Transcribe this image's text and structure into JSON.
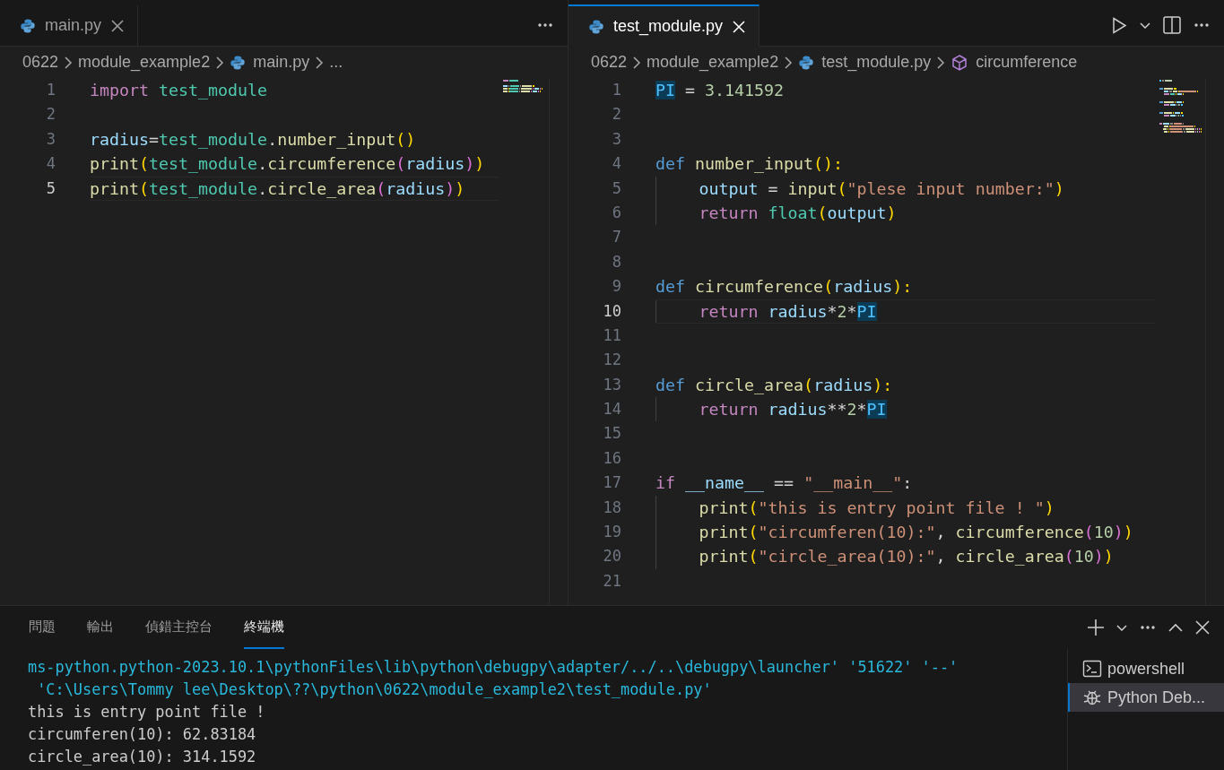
{
  "editor_groups": [
    {
      "tabs": [
        {
          "label": "main.py",
          "selected": false
        }
      ],
      "breadcrumbs": [
        {
          "label": "0622",
          "kind": "folder"
        },
        {
          "label": "module_example2",
          "kind": "folder"
        },
        {
          "label": "main.py",
          "kind": "file"
        },
        {
          "label": "...",
          "kind": "more"
        }
      ],
      "actions": [
        {
          "kind": "more"
        }
      ],
      "lines": [
        {
          "number": "1",
          "current": false,
          "nested": false,
          "tokens": [
            {
              "text": "import ",
              "kind": "kw"
            },
            {
              "text": "test_module",
              "kind": "mod"
            }
          ]
        },
        {
          "number": "2",
          "current": false,
          "nested": false
        },
        {
          "number": "3",
          "current": false,
          "nested": false,
          "tokens": [
            {
              "text": "radius",
              "kind": "var"
            },
            {
              "text": "=",
              "kind": "op"
            },
            {
              "text": "test_module",
              "kind": "mod"
            },
            {
              "text": ".",
              "kind": "op"
            },
            {
              "text": "number_input",
              "kind": "fn"
            },
            {
              "text": "()",
              "kind": "b1"
            }
          ]
        },
        {
          "number": "4",
          "current": false,
          "nested": false,
          "tokens": [
            {
              "text": "print",
              "kind": "fn"
            },
            {
              "text": "(",
              "kind": "b1"
            },
            {
              "text": "test_module",
              "kind": "mod"
            },
            {
              "text": ".",
              "kind": "op"
            },
            {
              "text": "circumference",
              "kind": "fn"
            },
            {
              "text": "(",
              "kind": "b2"
            },
            {
              "text": "radius",
              "kind": "var"
            },
            {
              "text": ")",
              "kind": "b2"
            },
            {
              "text": ")",
              "kind": "b1"
            }
          ]
        },
        {
          "number": "5",
          "current": true,
          "nested": false,
          "tokens": [
            {
              "text": "print",
              "kind": "fn"
            },
            {
              "text": "(",
              "kind": "b1"
            },
            {
              "text": "test_module",
              "kind": "mod"
            },
            {
              "text": ".",
              "kind": "op"
            },
            {
              "text": "circle_area",
              "kind": "fn"
            },
            {
              "text": "(",
              "kind": "b2"
            },
            {
              "text": "radius",
              "kind": "var"
            },
            {
              "text": ")",
              "kind": "b2"
            },
            {
              "text": ")",
              "kind": "b1"
            }
          ]
        }
      ]
    },
    {
      "tabs": [
        {
          "label": "test_module.py",
          "selected": true
        }
      ],
      "breadcrumbs": [
        {
          "label": "0622",
          "kind": "folder"
        },
        {
          "label": "module_example2",
          "kind": "folder"
        },
        {
          "label": "test_module.py",
          "kind": "file"
        },
        {
          "label": "circumference",
          "kind": "symbol"
        }
      ],
      "actions": [
        {
          "kind": "run"
        },
        {
          "kind": "menu"
        },
        {
          "kind": "split"
        },
        {
          "kind": "more"
        }
      ],
      "lines": [
        {
          "number": "1",
          "current": false,
          "nested": false,
          "tokens": [
            {
              "text": "PI",
              "kind": "match"
            },
            {
              "text": " = ",
              "kind": "op"
            },
            {
              "text": "3.141592",
              "kind": "num"
            }
          ]
        },
        {
          "number": "2",
          "current": false,
          "nested": false
        },
        {
          "number": "3",
          "current": false,
          "nested": false
        },
        {
          "number": "4",
          "current": false,
          "nested": false,
          "tokens": [
            {
              "text": "def ",
              "kind": "def"
            },
            {
              "text": "number_input",
              "kind": "fn"
            },
            {
              "text": "():",
              "kind": "b1"
            }
          ]
        },
        {
          "number": "5",
          "current": false,
          "nested": true,
          "tokens": [
            {
              "text": "output",
              "kind": "var"
            },
            {
              "text": " = ",
              "kind": "op"
            },
            {
              "text": "input",
              "kind": "fn"
            },
            {
              "text": "(",
              "kind": "b1"
            },
            {
              "text": "\"plese input number:\"",
              "kind": "str"
            },
            {
              "text": ")",
              "kind": "b1"
            }
          ]
        },
        {
          "number": "6",
          "current": false,
          "nested": true,
          "tokens": [
            {
              "text": "return ",
              "kind": "kw"
            },
            {
              "text": "float",
              "kind": "mod"
            },
            {
              "text": "(",
              "kind": "b1"
            },
            {
              "text": "output",
              "kind": "var"
            },
            {
              "text": ")",
              "kind": "b1"
            }
          ]
        },
        {
          "number": "7",
          "current": false,
          "nested": false
        },
        {
          "number": "8",
          "current": false,
          "nested": false
        },
        {
          "number": "9",
          "current": false,
          "nested": false,
          "tokens": [
            {
              "text": "def ",
              "kind": "def"
            },
            {
              "text": "circumference",
              "kind": "fn"
            },
            {
              "text": "(",
              "kind": "b1"
            },
            {
              "text": "radius",
              "kind": "var"
            },
            {
              "text": "):",
              "kind": "b1"
            }
          ]
        },
        {
          "number": "10",
          "current": true,
          "nested": true,
          "tokens": [
            {
              "text": "return ",
              "kind": "kw"
            },
            {
              "text": "radius",
              "kind": "var"
            },
            {
              "text": "*",
              "kind": "op"
            },
            {
              "text": "2",
              "kind": "num"
            },
            {
              "text": "*",
              "kind": "op"
            },
            {
              "text": "PI",
              "kind": "match"
            }
          ]
        },
        {
          "number": "11",
          "current": false,
          "nested": false
        },
        {
          "number": "12",
          "current": false,
          "nested": false
        },
        {
          "number": "13",
          "current": false,
          "nested": false,
          "tokens": [
            {
              "text": "def ",
              "kind": "def"
            },
            {
              "text": "circle_area",
              "kind": "fn"
            },
            {
              "text": "(",
              "kind": "b1"
            },
            {
              "text": "radius",
              "kind": "var"
            },
            {
              "text": "):",
              "kind": "b1"
            }
          ]
        },
        {
          "number": "14",
          "current": false,
          "nested": true,
          "tokens": [
            {
              "text": "return ",
              "kind": "kw"
            },
            {
              "text": "radius",
              "kind": "var"
            },
            {
              "text": "**",
              "kind": "op"
            },
            {
              "text": "2",
              "kind": "num"
            },
            {
              "text": "*",
              "kind": "op"
            },
            {
              "text": "PI",
              "kind": "match"
            }
          ]
        },
        {
          "number": "15",
          "current": false,
          "nested": false
        },
        {
          "number": "16",
          "current": false,
          "nested": false
        },
        {
          "number": "17",
          "current": false,
          "nested": false,
          "tokens": [
            {
              "text": "if ",
              "kind": "kw"
            },
            {
              "text": "__name__",
              "kind": "var"
            },
            {
              "text": " == ",
              "kind": "op"
            },
            {
              "text": "\"__main__\"",
              "kind": "str"
            },
            {
              "text": ":",
              "kind": "op"
            }
          ]
        },
        {
          "number": "18",
          "current": false,
          "nested": true,
          "tokens": [
            {
              "text": "print",
              "kind": "fn"
            },
            {
              "text": "(",
              "kind": "b1"
            },
            {
              "text": "\"this is entry point file ! \"",
              "kind": "str"
            },
            {
              "text": ")",
              "kind": "b1"
            }
          ]
        },
        {
          "number": "19",
          "current": false,
          "nested": true,
          "tokens": [
            {
              "text": "print",
              "kind": "fn"
            },
            {
              "text": "(",
              "kind": "b1"
            },
            {
              "text": "\"circumferen(10):\"",
              "kind": "str"
            },
            {
              "text": ", ",
              "kind": "op"
            },
            {
              "text": "circumference",
              "kind": "fn"
            },
            {
              "text": "(",
              "kind": "b2"
            },
            {
              "text": "10",
              "kind": "num"
            },
            {
              "text": ")",
              "kind": "b2"
            },
            {
              "text": ")",
              "kind": "b1"
            }
          ]
        },
        {
          "number": "20",
          "current": false,
          "nested": true,
          "tokens": [
            {
              "text": "print",
              "kind": "fn"
            },
            {
              "text": "(",
              "kind": "b1"
            },
            {
              "text": "\"circle_area(10):\"",
              "kind": "str"
            },
            {
              "text": ", ",
              "kind": "op"
            },
            {
              "text": "circle_area",
              "kind": "fn"
            },
            {
              "text": "(",
              "kind": "b2"
            },
            {
              "text": "10",
              "kind": "num"
            },
            {
              "text": ")",
              "kind": "b2"
            },
            {
              "text": ")",
              "kind": "b1"
            }
          ]
        },
        {
          "number": "21",
          "current": false,
          "nested": false
        }
      ]
    }
  ],
  "panel": {
    "tabs": [
      {
        "label": "問題",
        "selected": false
      },
      {
        "label": "輸出",
        "selected": false
      },
      {
        "label": "偵錯主控台",
        "selected": false
      },
      {
        "label": "終端機",
        "selected": true
      }
    ],
    "actions": [
      {
        "kind": "add"
      },
      {
        "kind": "menu"
      },
      {
        "kind": "more"
      },
      {
        "kind": "maximize"
      },
      {
        "kind": "close"
      }
    ],
    "terminal_lines": [
      {
        "text": "ms-python.python-2023.10.1\\pythonFiles\\lib\\python\\debugpy\\adapter/../..\\debugpy\\launcher' '51622' '--'",
        "kind": "command"
      },
      {
        "text": " 'C:\\Users\\Tommy lee\\Desktop\\??\\python\\0622\\module_example2\\test_module.py'",
        "kind": "command"
      },
      {
        "text": "this is entry point file !",
        "kind": "output"
      },
      {
        "text": "circumferen(10): 62.83184",
        "kind": "output"
      },
      {
        "text": "circle_area(10): 314.1592",
        "kind": "output"
      }
    ],
    "terminals": [
      {
        "label": "powershell",
        "kind": "shell",
        "selected": false
      },
      {
        "label": "Python Deb...",
        "kind": "debug",
        "selected": true
      }
    ]
  }
}
